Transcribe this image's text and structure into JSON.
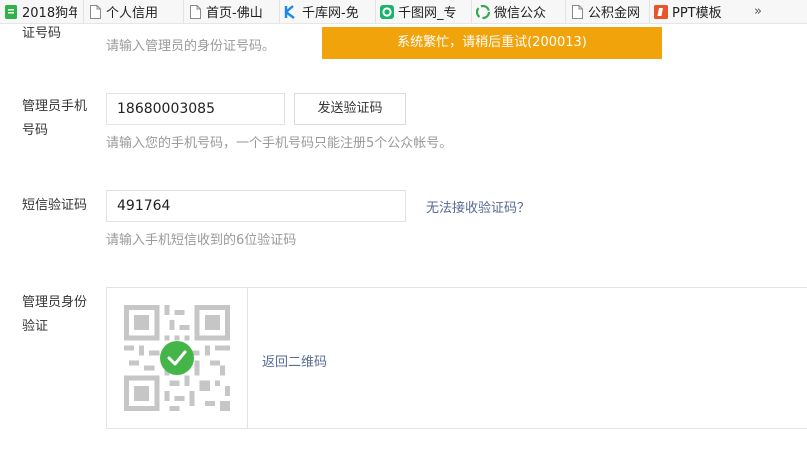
{
  "bookmarks": {
    "items": [
      {
        "label": "2018狗年",
        "icon": "green-doc-icon"
      },
      {
        "label": "个人信用",
        "icon": "page-icon"
      },
      {
        "label": "首页-佛山",
        "icon": "page-icon"
      },
      {
        "label": "千库网-免",
        "icon": "qianku-logo-icon"
      },
      {
        "label": "千图网_专",
        "icon": "qiantu-logo-icon"
      },
      {
        "label": "微信公众",
        "icon": "wechat-icon"
      },
      {
        "label": "公积金网",
        "icon": "page-icon"
      },
      {
        "label": "PPT模板",
        "icon": "ppt-icon"
      }
    ],
    "more": "»"
  },
  "form": {
    "id_section": {
      "label": "证号码",
      "hint": "请输入管理员的身份证号码。",
      "toast": "系统繁忙，请稍后重试(200013)"
    },
    "phone": {
      "label_line1": "管理员手机",
      "label_line2": "号码",
      "value": "18680003085",
      "send_button": "发送验证码",
      "hint": "请输入您的手机号码，一个手机号码只能注册5个公众帐号。"
    },
    "sms": {
      "label": "短信验证码",
      "value": "491764",
      "help_link": "无法接收验证码？",
      "hint": "请输入手机短信收到的6位验证码"
    },
    "identity": {
      "label_line1": "管理员身份",
      "label_line2": "验证",
      "back_link": "返回二维码"
    }
  },
  "colors": {
    "toast_bg": "#f0a30a",
    "success": "#44b549",
    "link": "#576b95"
  }
}
